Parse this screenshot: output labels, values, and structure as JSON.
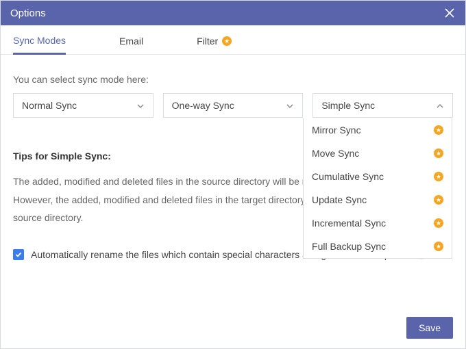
{
  "colors": {
    "accent": "#5964ab",
    "star": "#f5a623",
    "checkbox": "#3b7ded"
  },
  "window": {
    "title": "Options"
  },
  "tabs": [
    {
      "label": "Sync Modes",
      "active": true,
      "badge": false
    },
    {
      "label": "Email",
      "active": false,
      "badge": false
    },
    {
      "label": "Filter",
      "active": false,
      "badge": true
    }
  ],
  "hint": "You can select sync mode here:",
  "selects": [
    {
      "value": "Normal Sync",
      "open": false
    },
    {
      "value": "One-way Sync",
      "open": false
    },
    {
      "value": "Simple Sync",
      "open": true
    }
  ],
  "dropdown_options": [
    {
      "label": "Mirror Sync",
      "premium": true
    },
    {
      "label": "Move Sync",
      "premium": true
    },
    {
      "label": "Cumulative Sync",
      "premium": true
    },
    {
      "label": "Update Sync",
      "premium": true
    },
    {
      "label": "Incremental Sync",
      "premium": true
    },
    {
      "label": "Full Backup Sync",
      "premium": true
    }
  ],
  "tips": {
    "title": "Tips for Simple Sync:",
    "body": "The added, modified and deleted files in the source directory will be replicated to the target directory. However, the added, modified and deleted files in the target directory will not be replicated to the source directory."
  },
  "auto_rename": {
    "checked": true,
    "label": "Automatically rename the files which contain special characters and generate a script file."
  },
  "footer": {
    "save": "Save"
  }
}
